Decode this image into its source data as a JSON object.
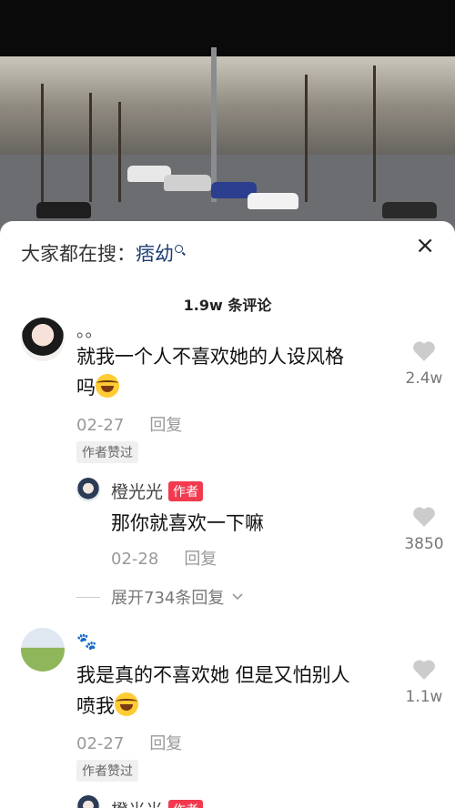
{
  "search": {
    "prefix": "大家都在搜：",
    "keyword": "痞幼"
  },
  "close_glyph": "×",
  "comment_count": "1.9w 条评论",
  "comments": [
    {
      "name": "。。",
      "text_line1": "就我一个人不喜欢她的人设风格",
      "text_line2": "吗",
      "date": "02-27",
      "reply": "回复",
      "badge": "作者赞过",
      "likes": "2.4w"
    },
    {
      "text_line1": "我是真的不喜欢她 但是又怕别人",
      "text_line2": "喷我",
      "date": "02-27",
      "reply": "回复",
      "badge": "作者赞过",
      "likes": "1.1w"
    }
  ],
  "replies": [
    {
      "name": "橙光光",
      "tag": "作者",
      "text": "那你就喜欢一下嘛",
      "date": "02-28",
      "reply": "回复",
      "likes": "3850"
    },
    {
      "name": "橙光光",
      "tag": "作者"
    }
  ],
  "expand": "展开734条回复",
  "colors": {
    "accent": "#f23a4f",
    "link": "#1f3e73",
    "heart": "#cccccc"
  }
}
